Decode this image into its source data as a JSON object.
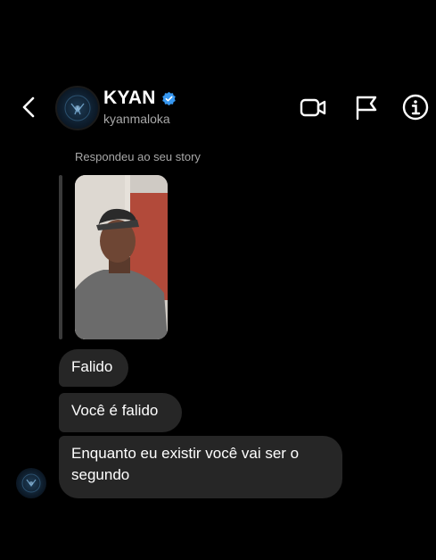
{
  "header": {
    "contact_name": "KYAN",
    "username": "kyanmaloka",
    "icons": [
      "back-icon",
      "verified-badge-icon",
      "video-call-icon",
      "flag-icon",
      "info-icon"
    ]
  },
  "thread": {
    "reply_note": "Respondeu ao seu story",
    "messages": [
      {
        "text": "Falido"
      },
      {
        "text": "Você é falido"
      },
      {
        "text": "Enquanto eu existir você vai ser o segundo"
      }
    ]
  },
  "colors": {
    "background": "#000000",
    "bubble": "#262626",
    "secondary_text": "#a8a8a8",
    "verified": "#3797f0"
  }
}
